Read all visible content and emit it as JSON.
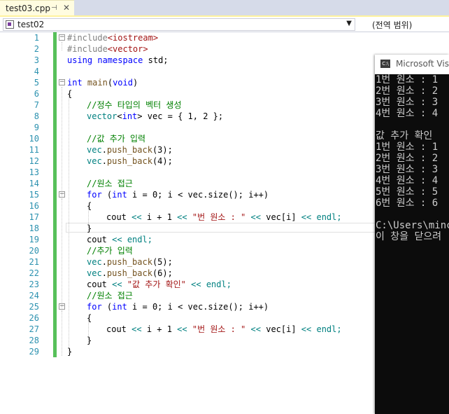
{
  "tab": {
    "title": "test03.cpp",
    "pin": "⊣",
    "close": "✕"
  },
  "navbar": {
    "scope": "test02",
    "member": "(전역 범위)"
  },
  "code_lines": [
    "1",
    "2",
    "3",
    "4",
    "5",
    "6",
    "7",
    "8",
    "9",
    "10",
    "11",
    "12",
    "13",
    "14",
    "15",
    "16",
    "17",
    "18",
    "19",
    "20",
    "21",
    "22",
    "23",
    "24",
    "25",
    "26",
    "27",
    "28",
    "29"
  ],
  "code": {
    "l1a": "#include",
    "l1b": "<iostream>",
    "l2a": "#include",
    "l2b": "<vector>",
    "l3a": "using",
    "l3b": " ",
    "l3c": "namespace",
    "l3d": " std;",
    "l5a": "int",
    "l5b": " ",
    "l5c": "main",
    "l5d": "(",
    "l5e": "void",
    "l5f": ")",
    "l6": "{",
    "l7": "//정수 타입의 벡터 생성",
    "l8a": "vector",
    "l8b": "<",
    "l8c": "int",
    "l8d": ">",
    "l8e": " vec = { 1, 2 };",
    "l10": "//값 추가 입력",
    "l11a": "vec",
    "l11b": ".",
    "l11c": "push_back",
    "l11d": "(3);",
    "l12a": "vec",
    "l12b": ".",
    "l12c": "push_back",
    "l12d": "(4);",
    "l14": "//원소 접근",
    "l15a": "for",
    "l15b": " (",
    "l15c": "int",
    "l15d": " i = 0; i < vec.size(); i++)",
    "l16": "{",
    "l17a": "cout",
    "l17b": " << ",
    "l17c": "i + 1",
    "l17d": " << ",
    "l17e": "\"번 원소 : \"",
    "l17f": " << ",
    "l17g": "vec[i]",
    "l17h": " << ",
    "l17i": "endl;",
    "l18": "}",
    "l19a": "cout",
    "l19b": " << ",
    "l19c": "endl;",
    "l20": "//추가 입력",
    "l21a": "vec",
    "l21b": ".",
    "l21c": "push_back",
    "l21d": "(5);",
    "l22a": "vec",
    "l22b": ".",
    "l22c": "push_back",
    "l22d": "(6);",
    "l23a": "cout",
    "l23b": " << ",
    "l23c": "\"값 추가 확인\"",
    "l23d": " << ",
    "l23e": "endl;",
    "l24": "//원소 접근",
    "l25a": "for",
    "l25b": " (",
    "l25c": "int",
    "l25d": " i = 0; i < vec.size(); i++)",
    "l26": "{",
    "l27a": "cout",
    "l27b": " << ",
    "l27c": "i + 1",
    "l27d": " << ",
    "l27e": "\"번 원소 : \"",
    "l27f": " << ",
    "l27g": "vec[i]",
    "l27h": " << ",
    "l27i": "endl;",
    "l28": "}",
    "l29": "}"
  },
  "console": {
    "title": "Microsoft Visu",
    "lines": [
      "1번 원소 : 1",
      "2번 원소 : 2",
      "3번 원소 : 3",
      "4번 원소 : 4",
      "",
      "값 추가 확인",
      "1번 원소 : 1",
      "2번 원소 : 2",
      "3번 원소 : 3",
      "4번 원소 : 4",
      "5번 원소 : 5",
      "6번 원소 : 6",
      "",
      "C:\\Users\\minc",
      "이 창을 닫으려"
    ]
  },
  "colors": {
    "keyword": "#0000ff",
    "string": "#a31515",
    "comment": "#008000",
    "line_number": "#2b91af",
    "change_bar": "#57c05a",
    "console_bg": "#0c0c0c"
  }
}
